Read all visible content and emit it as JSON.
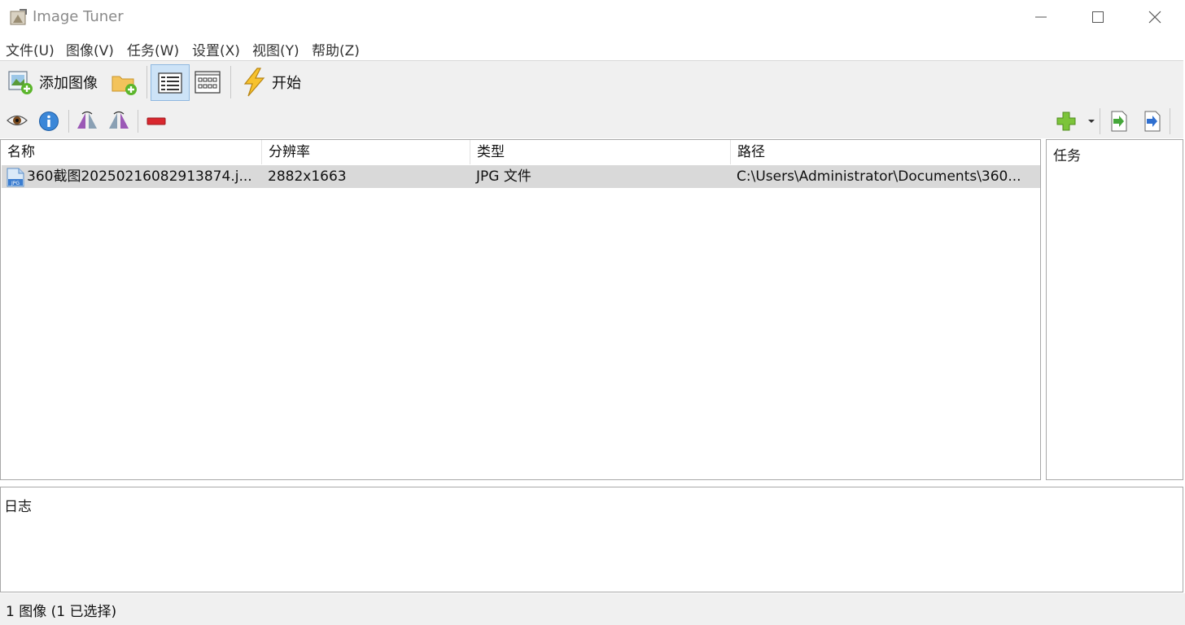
{
  "window": {
    "title": "Image Tuner",
    "icons": [
      "app-icon",
      "minimize-icon",
      "maximize-icon",
      "close-icon"
    ]
  },
  "menu": {
    "items": [
      "文件(U)",
      "图像(V)",
      "任务(W)",
      "设置(X)",
      "视图(Y)",
      "帮助(Z)"
    ]
  },
  "toolbar": {
    "add_images_label": "添加图像",
    "start_label": "开始",
    "icons": [
      "add-images-icon",
      "add-folder-icon",
      "details-view-icon",
      "thumbnails-view-icon",
      "lightning-icon"
    ]
  },
  "toolbar2": {
    "icons": [
      "preview-eye-icon",
      "info-icon",
      "flip-horizontal-icon",
      "flip-vertical-icon",
      "remove-icon",
      "add-task-icon",
      "dropdown-arrow-icon",
      "import-task-icon",
      "export-task-icon"
    ]
  },
  "list": {
    "columns": [
      "名称",
      "分辨率",
      "类型",
      "路径"
    ],
    "rows": [
      {
        "name": "360截图20250216082913874.j...",
        "resolution": "2882x1663",
        "type": "JPG 文件",
        "path": "C:\\Users\\Administrator\\Documents\\360...",
        "icon": "jpg-file-icon",
        "selected": true
      }
    ]
  },
  "tasks": {
    "header": "任务"
  },
  "log": {
    "header": "日志"
  },
  "status": {
    "text": "1 图像 (1 已选择)"
  },
  "colors": {
    "toolbar_bg": "#f0f0f0",
    "selected_row": "#d9d9d9",
    "pressed_button": "#cde3f7",
    "add_green": "#5bb52b",
    "remove_red": "#d9272e"
  }
}
